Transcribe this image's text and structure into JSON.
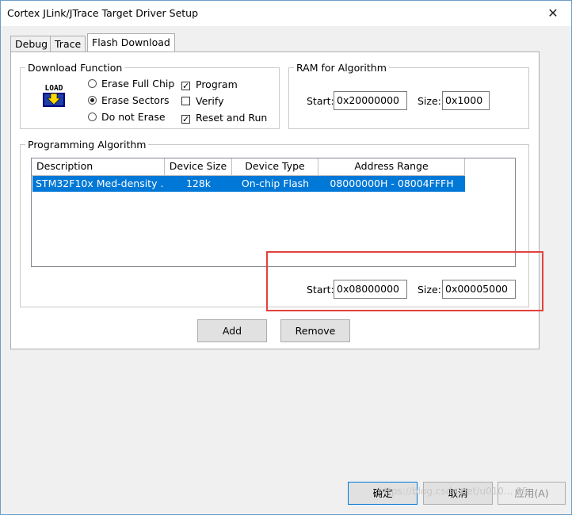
{
  "window": {
    "title": "Cortex JLink/JTrace Target Driver Setup",
    "close": "✕"
  },
  "tabs": [
    {
      "label": "Debug"
    },
    {
      "label": "Trace"
    },
    {
      "label": "Flash Download"
    }
  ],
  "download_function": {
    "label": "Download Function",
    "icon_text": "LOAD",
    "erase_full": "Erase Full Chip",
    "erase_sectors": "Erase Sectors",
    "do_not_erase": "Do not Erase",
    "program": "Program",
    "verify": "Verify",
    "reset_run": "Reset and Run"
  },
  "ram": {
    "label": "RAM for Algorithm",
    "start_label": "Start:",
    "start": "0x20000000",
    "size_label": "Size:",
    "size": "0x1000"
  },
  "algorithm": {
    "label": "Programming Algorithm",
    "columns": [
      "Description",
      "Device Size",
      "Device Type",
      "Address Range"
    ],
    "rows": [
      {
        "description": "STM32F10x Med-density ...",
        "size": "128k",
        "type": "On-chip Flash",
        "range": "08000000H - 08004FFFH"
      }
    ],
    "start_label": "Start:",
    "start": "0x08000000",
    "size_label": "Size:",
    "size": "0x00005000"
  },
  "buttons": {
    "add": "Add",
    "remove": "Remove",
    "ok": "确定",
    "cancel": "取消",
    "apply": "应用(A)"
  },
  "watermark": "https://blog.csdn.net/u010... 95",
  "colors": {
    "selection": "#0078d7",
    "annotation": "#e2413c"
  }
}
